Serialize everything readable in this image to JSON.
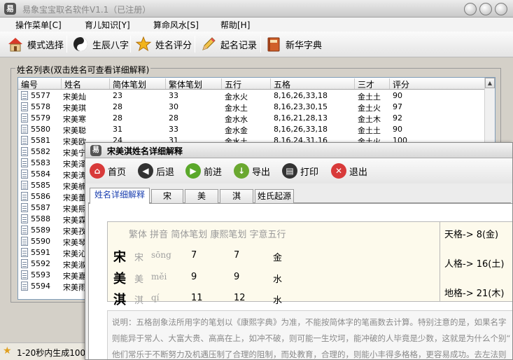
{
  "window": {
    "title": "易象宝宝取名软件V1.1（已注册）",
    "icon_label": "易"
  },
  "menu": [
    "操作菜单[C]",
    "育儿知识[Y]",
    "算命风水[S]",
    "帮助[H]"
  ],
  "toolbar": [
    "模式选择",
    "生辰八字",
    "姓名评分",
    "起名记录",
    "新华字典"
  ],
  "list": {
    "title": "姓名列表(双击姓名可查看详细解释)",
    "columns": [
      "编号",
      "姓名",
      "简体笔划",
      "繁体笔划",
      "五行",
      "五格",
      "三才",
      "评分"
    ],
    "rows": [
      [
        "5577",
        "宋美灿",
        "23",
        "33",
        "金水火",
        "8,16,26,33,18",
        "金土土",
        "90"
      ],
      [
        "5578",
        "宋美琪",
        "28",
        "30",
        "金水土",
        "8,16,23,30,15",
        "金土火",
        "97"
      ],
      [
        "5579",
        "宋美寒",
        "28",
        "28",
        "金水水",
        "8,16,21,28,13",
        "金土木",
        "92"
      ],
      [
        "5580",
        "宋美聪",
        "31",
        "33",
        "金水金",
        "8,16,26,33,18",
        "金土土",
        "90"
      ],
      [
        "5581",
        "宋美欧",
        "24",
        "31",
        "金水土",
        "8,16,24,31,16",
        "金土火",
        "100"
      ],
      [
        "5582",
        "宋美宁",
        "",
        "",
        "",
        "",
        "",
        ""
      ],
      [
        "5583",
        "宋美泽",
        "",
        "",
        "",
        "",
        "",
        ""
      ],
      [
        "5584",
        "宋美涛",
        "",
        "",
        "",
        "",
        "",
        ""
      ],
      [
        "5585",
        "宋美楠",
        "",
        "",
        "",
        "",
        "",
        ""
      ],
      [
        "5586",
        "宋美蕾",
        "",
        "",
        "",
        "",
        "",
        ""
      ],
      [
        "5587",
        "宋美熙",
        "",
        "",
        "",
        "",
        "",
        ""
      ],
      [
        "5588",
        "宋美霖",
        "",
        "",
        "",
        "",
        "",
        ""
      ],
      [
        "5589",
        "宋美孜",
        "",
        "",
        "",
        "",
        "",
        ""
      ],
      [
        "5590",
        "宋美琴",
        "",
        "",
        "",
        "",
        "",
        ""
      ],
      [
        "5591",
        "宋美沁",
        "",
        "",
        "",
        "",
        "",
        ""
      ],
      [
        "5592",
        "宋美淑",
        "",
        "",
        "",
        "",
        "",
        ""
      ],
      [
        "5593",
        "宋美嘉",
        "",
        "",
        "",
        "",
        "",
        ""
      ],
      [
        "5594",
        "宋美雨",
        "",
        "",
        "",
        "",
        "",
        ""
      ]
    ]
  },
  "status": {
    "text": "1-20秒内生成100"
  },
  "dialog": {
    "title": "宋美淇姓名详细解释",
    "toolbar": [
      "首页",
      "后退",
      "前进",
      "导出",
      "打印",
      "退出"
    ],
    "tabs": [
      "姓名详细解释",
      "宋",
      "美",
      "淇",
      "姓氏起源"
    ],
    "header": "繁体 拼音 简体笔划 康熙笔划 字意五行",
    "chars": [
      {
        "char": "宋",
        "trad": "宋",
        "pinyin": "sōng",
        "simp": "7",
        "kangxi": "7",
        "wuxing": "金"
      },
      {
        "char": "美",
        "trad": "美",
        "pinyin": "měi",
        "simp": "9",
        "kangxi": "9",
        "wuxing": "水"
      },
      {
        "char": "淇",
        "trad": "淇",
        "pinyin": "qí",
        "simp": "11",
        "kangxi": "12",
        "wuxing": "水"
      }
    ],
    "grids": [
      "天格-> 8(金)",
      "人格-> 16(土)",
      "地格-> 21(木)"
    ],
    "note": [
      "说明：五格剖象法所用字的笔划以《康熙字典》为准，不能按简体字的笔画数去计算。特别注意的是，如果名字",
      "则能异于常人、大富大贵、高高在上，如冲不破，则可能一生坎坷，能冲破的人毕竟是少数，这就是为什么个别“",
      "他们常乐于不断努力及机遇压制了合理的阻制，而处教育，合理的，则能小丰得多格格，更容易成功。去左法则"
    ]
  },
  "colors": {
    "accent": "#1a3fb0",
    "list_border": "#7f9db9"
  }
}
